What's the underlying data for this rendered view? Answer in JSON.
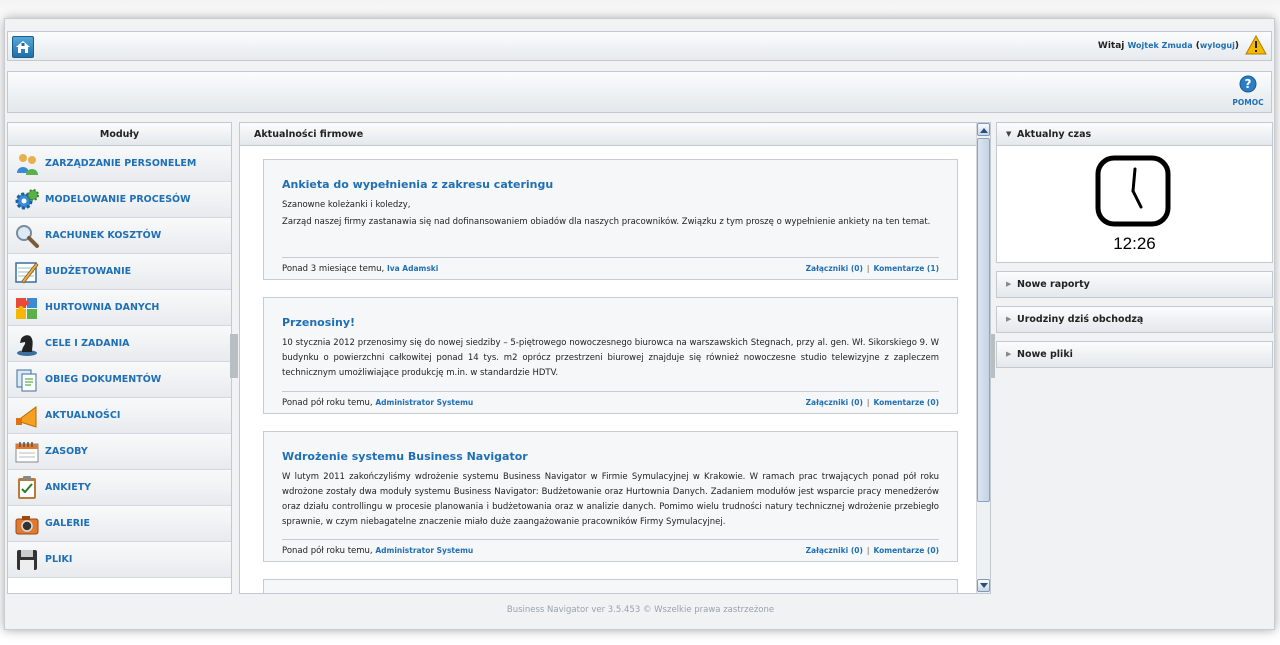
{
  "header": {
    "welcome_prefix": "Witaj",
    "user_name": "Wojtek Zmuda",
    "logout_label": "wyloguj"
  },
  "toolbar": {
    "help_label": "POMOC"
  },
  "modules": {
    "title": "Moduły",
    "items": [
      {
        "label": "ZARZĄDZANIE PERSONELEM",
        "icon": "people-icon"
      },
      {
        "label": "MODELOWANIE PROCESÓW",
        "icon": "gears-icon"
      },
      {
        "label": "RACHUNEK KOSZTÓW",
        "icon": "magnifier-icon"
      },
      {
        "label": "BUDŻETOWANIE",
        "icon": "pencil-board-icon"
      },
      {
        "label": "HURTOWNIA DANYCH",
        "icon": "puzzle-icon"
      },
      {
        "label": "CELE I ZADANIA",
        "icon": "chess-knight-icon"
      },
      {
        "label": "OBIEG DOKUMENTÓW",
        "icon": "documents-icon"
      },
      {
        "label": "AKTUALNOŚCI",
        "icon": "megaphone-icon"
      },
      {
        "label": "ZASOBY",
        "icon": "calendar-icon"
      },
      {
        "label": "ANKIETY",
        "icon": "clipboard-icon"
      },
      {
        "label": "GALERIE",
        "icon": "camera-icon"
      },
      {
        "label": "PLIKI",
        "icon": "floppy-icon"
      }
    ]
  },
  "news": {
    "title": "Aktualności firmowe",
    "items": [
      {
        "title": "Ankieta do wypełnienia z zakresu cateringu",
        "paragraphs": [
          "Szanowne koleżanki i koledzy,",
          "Zarząd naszej firmy zastanawia się nad dofinansowaniem obiadów dla naszych pracowników. Związku z tym proszę o wypełnienie ankiety na ten temat."
        ],
        "time": "Ponad 3 miesiące temu,",
        "author": "Iva Adamski",
        "attachments": "Załączniki (0)",
        "comments": "Komentarze (1)"
      },
      {
        "title": "Przenosiny!",
        "paragraphs": [
          "10 stycznia 2012 przenosimy się do nowej siedziby – 5-piętrowego nowoczesnego biurowca na warszawskich Stegnach, przy al. gen. Wł. Sikorskiego 9. W budynku o powierzchni całkowitej ponad 14 tys. m2 oprócz przestrzeni biurowej znajduje się również nowoczesne studio telewizyjne z zapleczem technicznym umożliwiające produkcję m.in. w standardzie HDTV."
        ],
        "time": "Ponad pół roku temu,",
        "author": "Administrator Systemu",
        "attachments": "Załączniki (0)",
        "comments": "Komentarze (0)"
      },
      {
        "title": "Wdrożenie systemu Business Navigator",
        "paragraphs": [
          "W lutym 2011 zakończyliśmy wdrożenie systemu Business Navigator w Firmie Symulacyjnej w Krakowie. W ramach prac trwających ponad pół roku wdrożone zostały dwa moduły systemu Business Navigator: Budżetowanie oraz Hurtownia Danych. Zadaniem modułów jest wsparcie pracy menedżerów oraz działu controllingu w procesie planowania i budżetowania oraz w analizie danych. Pomimo wielu trudności natury technicznej wdrożenie przebiegło sprawnie, w czym niebagatelne znaczenie miało duże zaangażowanie pracowników Firmy Symulacyjnej."
        ],
        "time": "Ponad pół roku temu,",
        "author": "Administrator Systemu",
        "attachments": "Załączniki (0)",
        "comments": "Komentarze (0)"
      }
    ]
  },
  "right_panel": {
    "clock_title": "Aktualny czas",
    "clock_time": "12:26",
    "sections": [
      "Nowe raporty",
      "Urodziny dziś obchodzą",
      "Nowe pliki"
    ]
  },
  "footer": {
    "text": "Business Navigator ver 3.5.453 © Wszelkie prawa zastrzeżone"
  },
  "colors": {
    "link": "#1f6fb5",
    "header_bg": "#e4e8ec",
    "warning": "#f5b800"
  }
}
